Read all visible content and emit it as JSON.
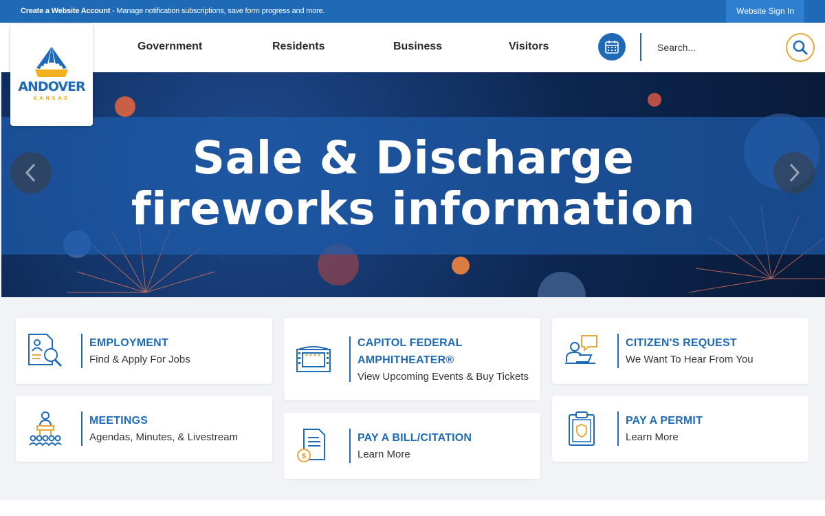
{
  "topbar": {
    "create_account": "Create a Website Account",
    "message": " - Manage notification subscriptions, save form progress and more.",
    "sign_in": "Website Sign In"
  },
  "logo": {
    "name": "ANDOVER",
    "state": "KANSAS",
    "colors": {
      "blue": "#1f6ab6",
      "gold": "#f2b01e"
    }
  },
  "nav": {
    "items": [
      "Government",
      "Residents",
      "Business",
      "Visitors"
    ]
  },
  "search": {
    "placeholder": "Search..."
  },
  "hero": {
    "line1": "Sale & Discharge",
    "line2": "fireworks information"
  },
  "cards": [
    {
      "name": "employment",
      "title": "EMPLOYMENT",
      "subtitle": "Find & Apply For Jobs",
      "icon": "job-search-icon"
    },
    {
      "name": "amphitheater",
      "title": "CAPITOL FEDERAL",
      "title2": "AMPHITHEATER®",
      "subtitle": "View Upcoming Events & Buy Tickets",
      "icon": "stage-icon"
    },
    {
      "name": "citizens-request",
      "title": "CITIZEN'S REQUEST",
      "subtitle": "We Want To Hear From You",
      "icon": "chat-person-icon"
    },
    {
      "name": "meetings",
      "title": "MEETINGS",
      "subtitle": "Agendas, Minutes, & Livestream",
      "icon": "meeting-podium-icon"
    },
    {
      "name": "pay-bill",
      "title": "PAY A BILL/CITATION",
      "subtitle": "Learn More",
      "icon": "bill-payment-icon"
    },
    {
      "name": "pay-permit",
      "title": "PAY A PERMIT",
      "subtitle": "Learn More",
      "icon": "permit-clipboard-icon"
    }
  ],
  "colors": {
    "primary": "#1f6ab6",
    "accent": "#e8a93a",
    "background": "#f1f3f6"
  }
}
